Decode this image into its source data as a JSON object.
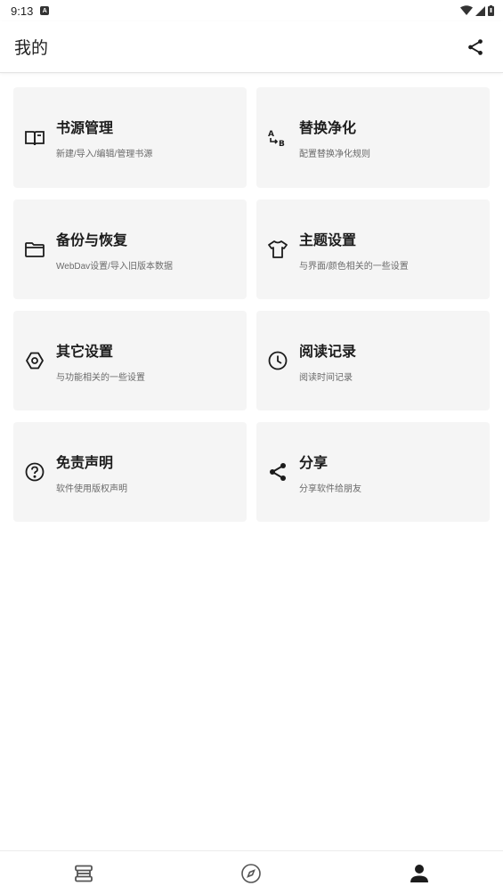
{
  "status_bar": {
    "time": "9:13",
    "notification_icon": "A"
  },
  "app_bar": {
    "title": "我的",
    "action_icon": "share-icon"
  },
  "cards": [
    {
      "title": "书源管理",
      "subtitle": "新建/导入/编辑/管理书源",
      "icon": "book-icon"
    },
    {
      "title": "替换净化",
      "subtitle": "配置替换净化规则",
      "icon": "find-replace-icon"
    },
    {
      "title": "备份与恢复",
      "subtitle": "WebDav设置/导入旧版本数据",
      "icon": "folder-icon"
    },
    {
      "title": "主题设置",
      "subtitle": "与界面/颜色相关的一些设置",
      "icon": "tshirt-icon"
    },
    {
      "title": "其它设置",
      "subtitle": "与功能相关的一些设置",
      "icon": "settings-icon"
    },
    {
      "title": "阅读记录",
      "subtitle": "阅读时间记录",
      "icon": "clock-icon"
    },
    {
      "title": "免责声明",
      "subtitle": "软件使用版权声明",
      "icon": "help-circle-icon"
    },
    {
      "title": "分享",
      "subtitle": "分享软件给朋友",
      "icon": "share-icon"
    }
  ],
  "bottom_nav": [
    {
      "icon": "bookshelf-icon",
      "selected": false
    },
    {
      "icon": "compass-icon",
      "selected": false
    },
    {
      "icon": "person-icon",
      "selected": true
    }
  ],
  "colors": {
    "card_bg": "#f5f5f5",
    "icon": "#1c1c1c",
    "nav_inactive": "#555555",
    "nav_active": "#1c1c1c"
  }
}
